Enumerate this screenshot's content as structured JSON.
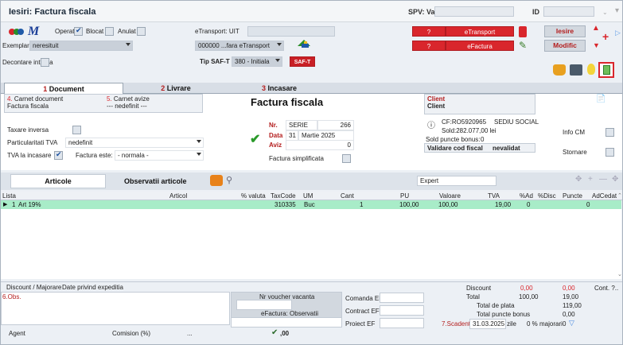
{
  "window": {
    "title": "Iesiri: Factura fiscala",
    "spv_label": "SPV: Val.",
    "id_label": "ID"
  },
  "toolbar": {
    "operat_label": "Operat",
    "blocat_label": "Blocat",
    "anulat_label": "Anulat",
    "etransport_label": "eTransport: UIT",
    "exemplar_label": "Exemplar 2:",
    "exemplar_value": "neresituit",
    "etransport_select": "000000 ...fara eTransport",
    "decontare_label": "Decontare interna",
    "tip_saft_label": "Tip SAF-T",
    "tip_saft_value": "380 - Initiala",
    "saft_badge": "SAF-T",
    "q1": "?",
    "q2": "?",
    "etransport_badge": "eTransport",
    "efactura_badge": "eFactura",
    "iesire_btn": "Iesire",
    "modific_btn": "Modific"
  },
  "tabs": [
    {
      "num": "1",
      "label": "Document"
    },
    {
      "num": "2",
      "label": "Livrare"
    },
    {
      "num": "3",
      "label": "Incasare"
    }
  ],
  "doc": {
    "carnet_doc_num": "4.",
    "carnet_doc_label": "Carnet document",
    "carnet_doc_value": "Factura fiscala",
    "carnet_avize_num": "5.",
    "carnet_avize_label": "Carnet avize",
    "carnet_avize_value": "--- nedefinit ---",
    "heading": "Factura fiscala",
    "taxare_inversa": "Taxare inversa",
    "particularitati_label": "Particularitati TVA",
    "particularitati_value": "nedefinit",
    "tva_incasare": "TVA la incasare",
    "factura_este_label": "Factura este:",
    "factura_este_value": "- normala -",
    "nr_label": "Nr.",
    "serie": "SERIE",
    "nr_value": "266",
    "data_label": "Data",
    "data_day": "31",
    "data_month": "Martie 2025",
    "aviz_label": "Aviz",
    "aviz_value": "0",
    "simplificata": "Factura simplificata",
    "client_label1": "Client",
    "client_label2": "Client",
    "cf": "CF:RO5920965",
    "sediu": "SEDIU SOCIAL",
    "sold": "Sold:282.077,00 lei",
    "sold_bonus": "Sold puncte bonus:",
    "sold_bonus_value": "0",
    "validare": "Validare cod fiscal",
    "nevalidat": "nevalidat",
    "info_cm": "Info CM",
    "stornare": "Stornare"
  },
  "subtabs": {
    "articole": "Articole",
    "observatii": "Observatii articole",
    "expert": "Expert"
  },
  "grid": {
    "headers": [
      "Lista",
      "Articol",
      "% valuta",
      "TaxCode",
      "UM",
      "Cant",
      "PU",
      "Valoare",
      "TVA",
      "%Ad",
      "%Disc",
      "Puncte",
      "AdCedat"
    ],
    "rows": [
      {
        "lista": "1",
        "articol": "Art 19%",
        "taxcode": "310335",
        "um": "Buc",
        "cant": "1",
        "pu": "100,00",
        "valoare": "100,00",
        "tva": "19,00",
        "ad": "0",
        "disc": "",
        "puncte": "0"
      }
    ]
  },
  "bottom": {
    "discount_tab": "Discount / Majorare",
    "expeditie_tab": "Date privind expeditia",
    "obs_label": "6.Obs.",
    "voucher_label": "Nr voucher vacanta",
    "efactura_obs": "eFactura: Observatii",
    "comanda_ef": "Comanda EF",
    "contract_ef": "Contract EF",
    "proiect_ef": "Proiect EF",
    "discount_label": "Discount",
    "discount_v1": "0,00",
    "discount_v2": "0,00",
    "total_label": "Total",
    "total_v1": "100,00",
    "total_v2": "19,00",
    "total_plata_label": "Total de plata",
    "total_plata_value": "119,00",
    "total_bonus_label": "Total puncte bonus",
    "total_bonus_value": "0,00",
    "cont_label": "Cont. ?..",
    "agent_label": "Agent",
    "comision_label": "Comision (%)",
    "comision_more": "...",
    "check_value": ",00",
    "scadenta_label": "7.Scadenta",
    "scadenta_value": "31.03.2025",
    "zile": "zile",
    "majorari": "0 % majorari",
    "majorari_value": "0"
  },
  "colors": {
    "accent_red": "#d9262c",
    "row_green": "#a8ecc8",
    "panel_blue": "#ecf0f5"
  }
}
